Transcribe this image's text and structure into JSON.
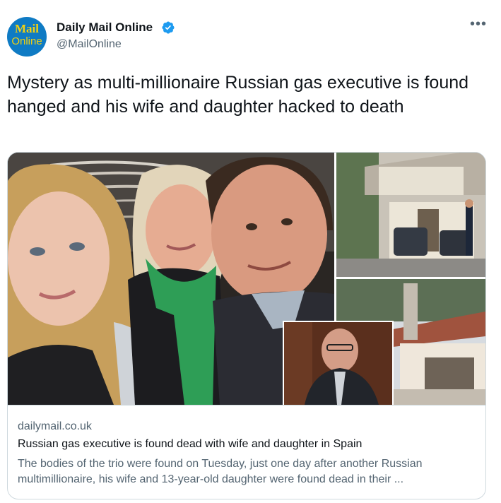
{
  "account": {
    "avatar_top": "Mail",
    "avatar_bottom": "Online",
    "name": "Daily Mail Online",
    "handle": "@MailOnline",
    "verified": true
  },
  "tweet": {
    "text": "Mystery as multi-millionaire Russian gas executive is found hanged and his wife and daughter hacked to death"
  },
  "card": {
    "domain": "dailymail.co.uk",
    "title": "Russian gas executive is found dead with wife and daughter in Spain",
    "description": "The bodies of the trio were found on Tuesday, just one day after another Russian multimillionaire, his wife and 13-year-old daughter were found dead in their ..."
  },
  "icons": {
    "more": "more-horizontal-icon",
    "verified": "verified-badge-icon"
  },
  "colors": {
    "brand_blue": "#0f7bc4",
    "brand_yellow": "#f4d10f",
    "verified": "#1d9bf0",
    "secondary_text": "#536471",
    "border": "#cfd9de"
  }
}
